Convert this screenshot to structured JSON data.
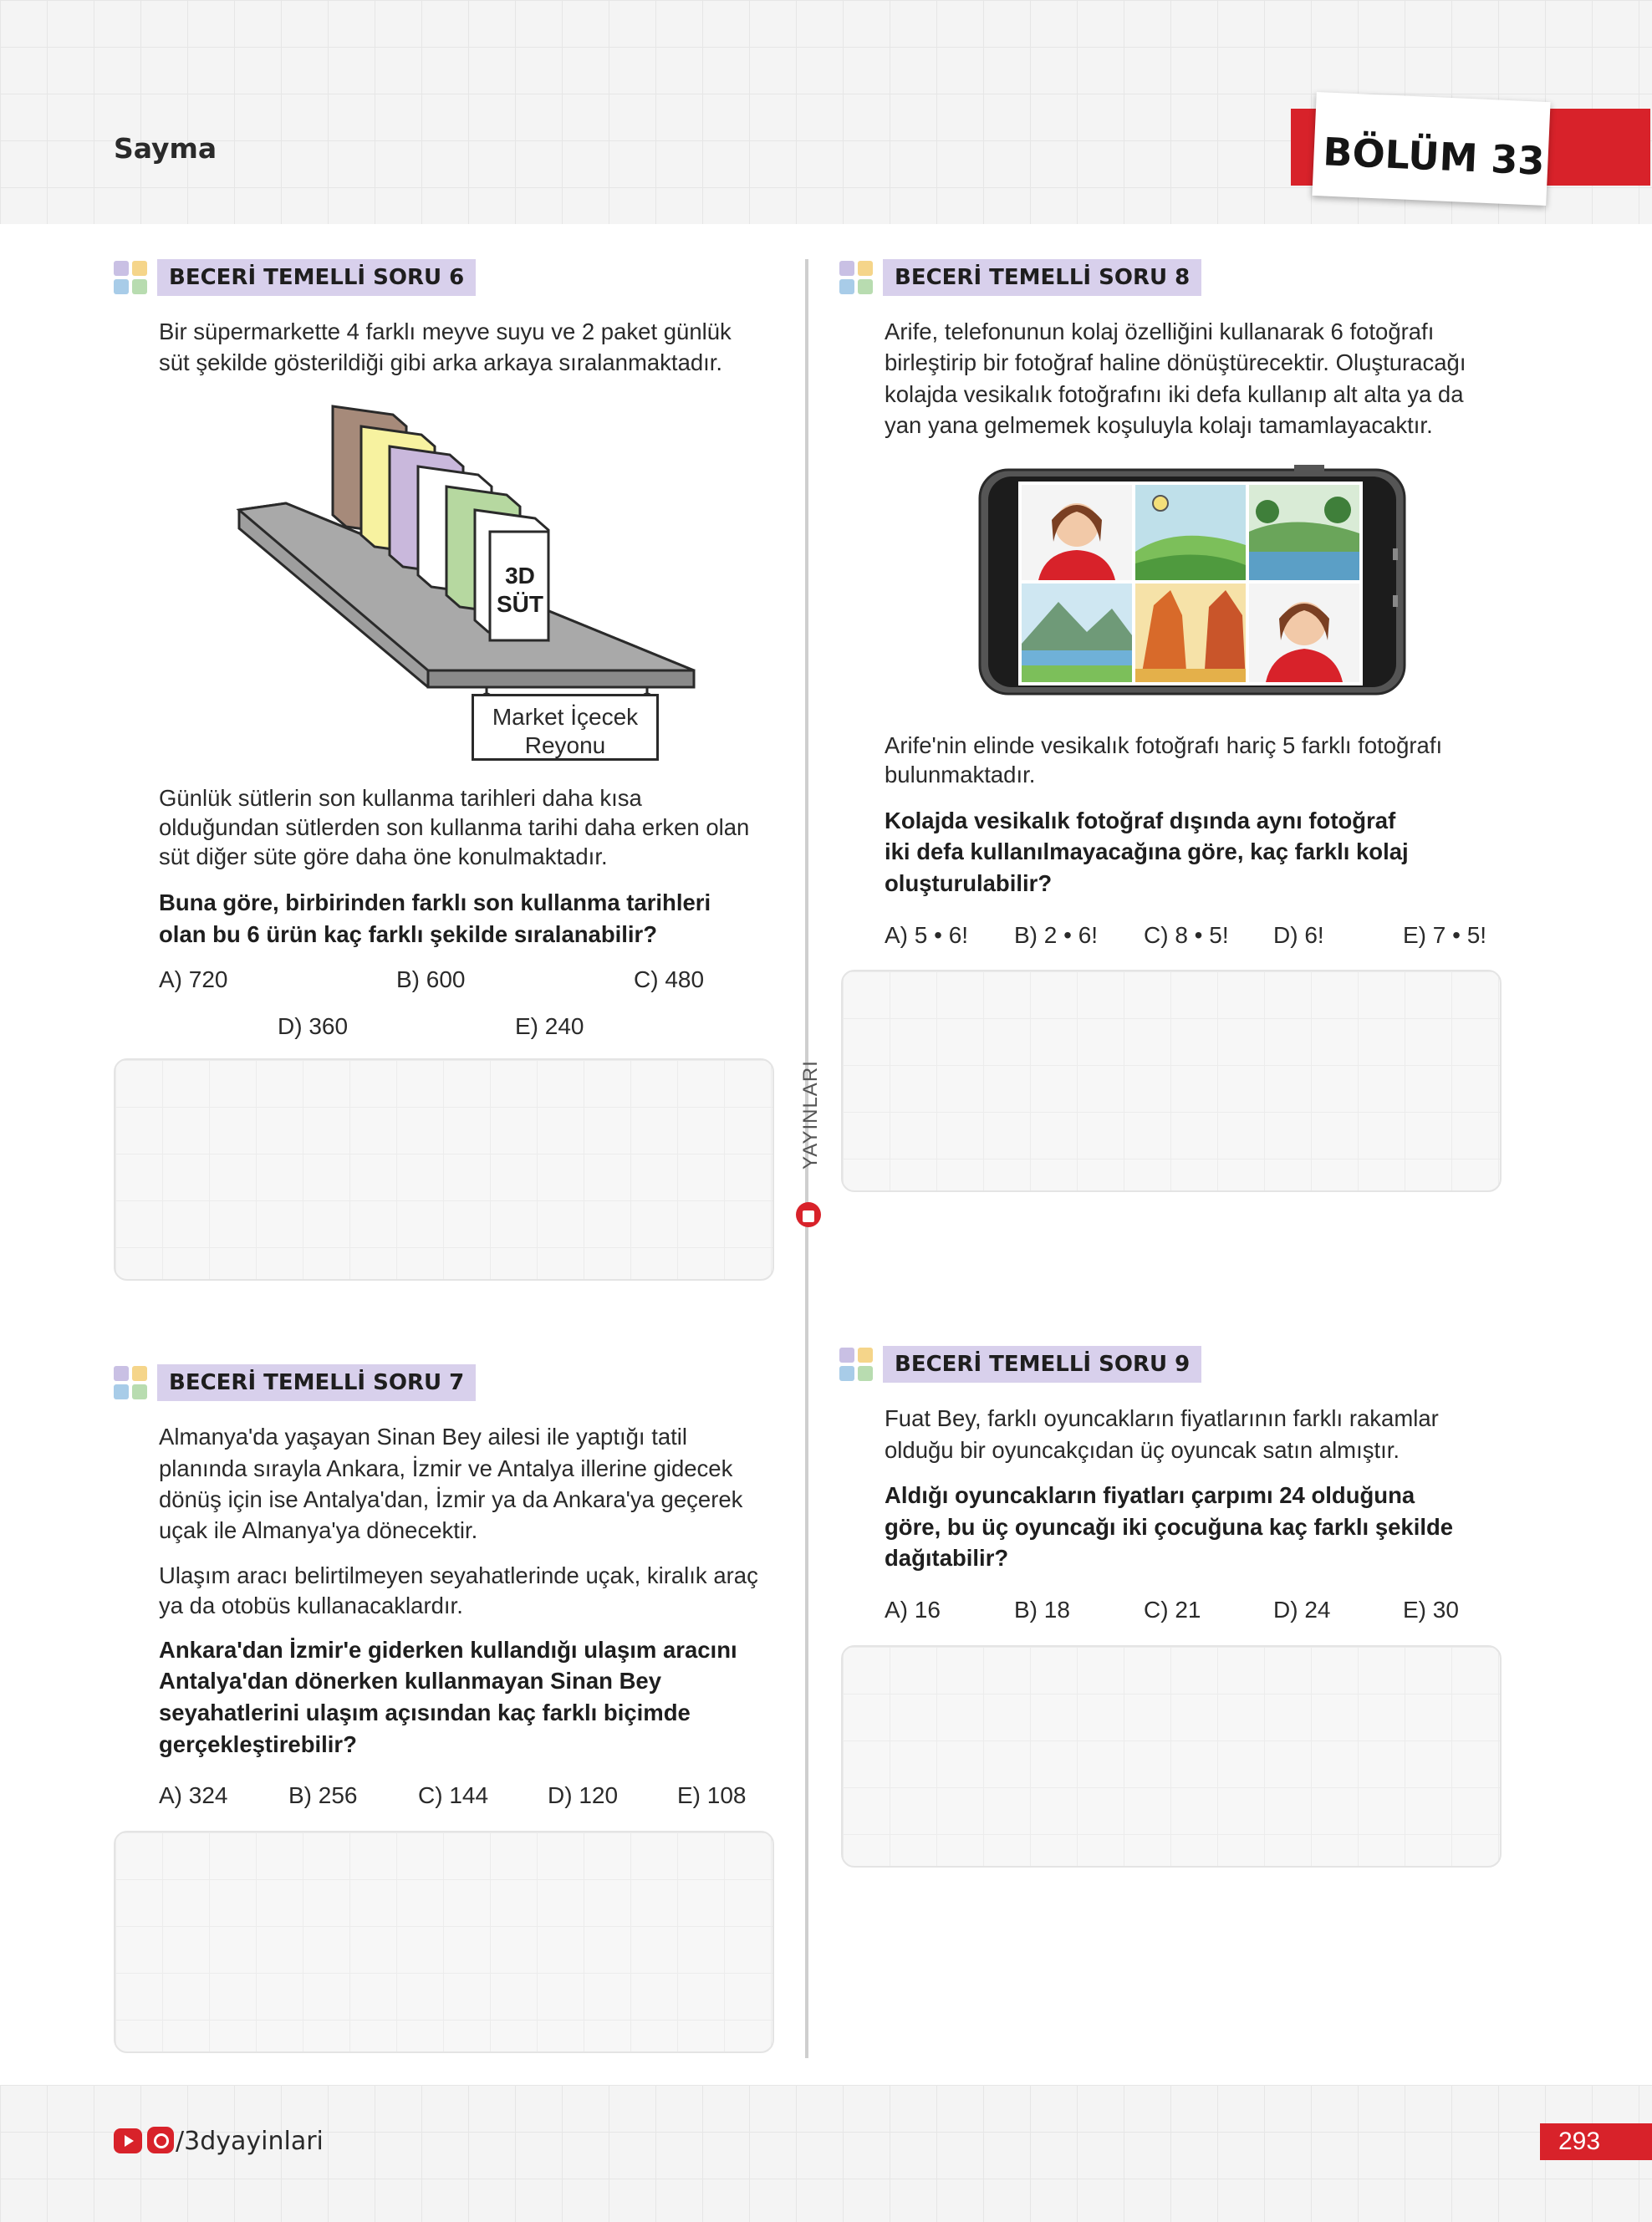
{
  "header": {
    "section": "Sayma",
    "chapter": "BÖLÜM 33"
  },
  "sidebar": {
    "publisher": "YAYINLARI"
  },
  "q6": {
    "label": "BECERİ TEMELLİ SORU 6",
    "intro_1": "Bir süpermarkette 4 farklı meyve suyu ve 2 paket günlük",
    "intro_2": "süt şekilde gösterildiği gibi arka arkaya sıralanmaktadır.",
    "figure": {
      "box_label": "3D",
      "box_label_2": "SÜT",
      "sign_line_1": "Market İçecek",
      "sign_line_2": "Reyonu"
    },
    "body_1": "Günlük sütlerin son kullanma tarihleri daha kısa",
    "body_2": "olduğundan sütlerden son kullanma tarihi daha erken olan",
    "body_3": "süt diğer süte göre daha öne konulmaktadır.",
    "question_1": "Buna göre, birbirinden farklı son kullanma tarihleri",
    "question_2": "olan bu 6 ürün kaç farklı şekilde sıralanabilir?",
    "options": [
      "A) 720",
      "B) 600",
      "C) 480",
      "D) 360",
      "E) 240"
    ]
  },
  "q7": {
    "label": "BECERİ TEMELLİ SORU 7",
    "p1_1": "Almanya'da yaşayan Sinan Bey ailesi ile yaptığı tatil",
    "p1_2": "planında sırayla Ankara, İzmir ve Antalya illerine gidecek",
    "p1_3": "dönüş için ise Antalya'dan, İzmir ya da Ankara'ya geçerek",
    "p1_4": "uçak ile Almanya'ya dönecektir.",
    "p2_1": "Ulaşım aracı belirtilmeyen seyahatlerinde uçak, kiralık araç",
    "p2_2": "ya da otobüs kullanacaklardır.",
    "question_1": "Ankara'dan İzmir'e giderken kullandığı ulaşım aracını",
    "question_2": "Antalya'dan dönerken kullanmayan Sinan Bey",
    "question_3": "seyahatlerini ulaşım açısından kaç farklı biçimde",
    "question_4": "gerçekleştirebilir?",
    "options": [
      "A) 324",
      "B) 256",
      "C) 144",
      "D) 120",
      "E) 108"
    ]
  },
  "q8": {
    "label": "BECERİ TEMELLİ SORU 8",
    "intro_1": "Arife, telefonunun kolaj özelliğini kullanarak 6 fotoğrafı",
    "intro_2": "birleştirip bir fotoğraf haline dönüştürecektir. Oluşturacağı",
    "intro_3": "kolajda vesikalık fotoğrafını iki defa kullanıp alt alta ya da",
    "intro_4": "yan yana gelmemek koşuluyla kolajı tamamlayacaktır.",
    "body_1": "Arife'nin elinde vesikalık fotoğrafı hariç 5 farklı fotoğrafı",
    "body_2": "bulunmaktadır.",
    "question_1": "Kolajda vesikalık fotoğraf dışında aynı fotoğraf",
    "question_2": "iki defa kullanılmayacağına göre, kaç farklı kolaj",
    "question_3": "oluşturulabilir?",
    "options": [
      "A) 5 • 6!",
      "B) 2 • 6!",
      "C) 8 • 5!",
      "D) 6!",
      "E) 7 • 5!"
    ]
  },
  "q9": {
    "label": "BECERİ TEMELLİ SORU 9",
    "intro_1": "Fuat Bey, farklı oyuncakların fiyatlarının farklı rakamlar",
    "intro_2": "olduğu bir oyuncakçıdan üç oyuncak satın almıştır.",
    "question_1": "Aldığı oyuncakların fiyatları çarpımı 24 olduğuna",
    "question_2": "göre, bu üç oyuncağı iki çocuğuna kaç farklı şekilde",
    "question_3": "dağıtabilir?",
    "options": [
      "A) 16",
      "B) 18",
      "C) 21",
      "D) 24",
      "E) 30"
    ]
  },
  "footer": {
    "handle": "/3dyayinlari",
    "page_number": "293"
  }
}
